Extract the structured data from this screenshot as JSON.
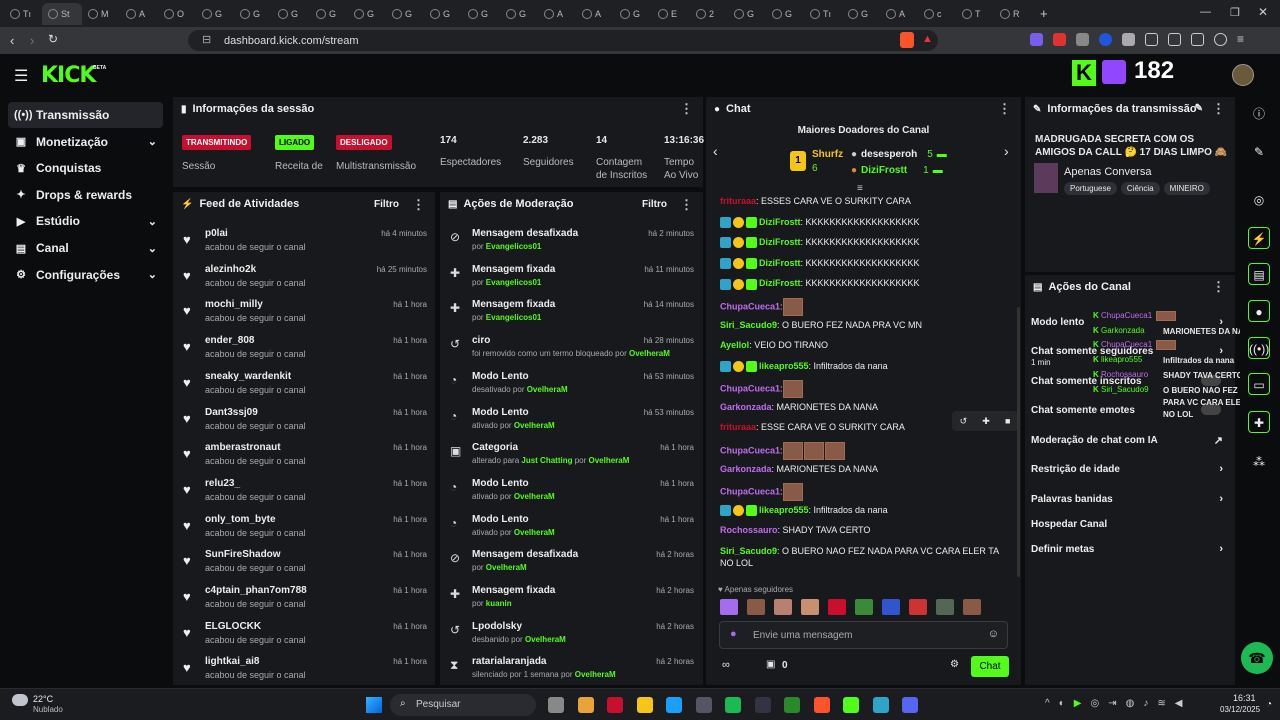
{
  "browser": {
    "tabs": [
      "Tı",
      "St",
      "M",
      "A",
      "O",
      "G",
      "G",
      "G",
      "G",
      "G",
      "G",
      "G",
      "G",
      "G",
      "A",
      "A",
      "G",
      "E",
      "2",
      "G",
      "G",
      "Tı",
      "G",
      "A",
      "c",
      "T",
      "R"
    ],
    "url": "dashboard.kick.com/stream"
  },
  "header": {
    "logo": "KICK",
    "beta": "BETA",
    "viewer_count": "182"
  },
  "sidebar": {
    "items": [
      {
        "label": "Transmissão",
        "icon": "broadcast-icon"
      },
      {
        "label": "Monetização",
        "icon": "money-icon"
      },
      {
        "label": "Conquistas",
        "icon": "trophy-icon"
      },
      {
        "label": "Drops & rewards",
        "icon": "gift-icon"
      },
      {
        "label": "Estúdio",
        "icon": "studio-icon"
      },
      {
        "label": "Canal",
        "icon": "channel-icon"
      },
      {
        "label": "Configurações",
        "icon": "gear-icon"
      }
    ]
  },
  "session": {
    "title": "Informações da sessão",
    "status": [
      {
        "badge": "TRANSMITINDO",
        "label": "Sessão"
      },
      {
        "badge": "LIGADO",
        "label": "Receita de"
      },
      {
        "badge": "DESLIGADO",
        "label": "Multistransmissão"
      }
    ],
    "stats": [
      {
        "value": "174",
        "label": "Espectadores"
      },
      {
        "value": "2.283",
        "label": "Seguidores"
      },
      {
        "value": "14",
        "label": "Contagem de Inscritos"
      },
      {
        "value": "13:16:36",
        "label": "Tempo Ao Vivo"
      }
    ]
  },
  "feed": {
    "title": "Feed de Atividades",
    "filter": "Filtro",
    "items": [
      {
        "name": "p0lai",
        "sub": "acabou de seguir o canal",
        "time": "há 4 minutos"
      },
      {
        "name": "alezinho2k",
        "sub": "acabou de seguir o canal",
        "time": "há 25 minutos"
      },
      {
        "name": "mochi_milly",
        "sub": "acabou de seguir o canal",
        "time": "há 1 hora"
      },
      {
        "name": "ender_808",
        "sub": "acabou de seguir o canal",
        "time": "há 1 hora"
      },
      {
        "name": "sneaky_wardenkit",
        "sub": "acabou de seguir o canal",
        "time": "há 1 hora"
      },
      {
        "name": "Dant3ssj09",
        "sub": "acabou de seguir o canal",
        "time": "há 1 hora"
      },
      {
        "name": "amberastronaut",
        "sub": "acabou de seguir o canal",
        "time": "há 1 hora"
      },
      {
        "name": "relu23_",
        "sub": "acabou de seguir o canal",
        "time": "há 1 hora"
      },
      {
        "name": "only_tom_byte",
        "sub": "acabou de seguir o canal",
        "time": "há 1 hora"
      },
      {
        "name": "SunFireShadow",
        "sub": "acabou de seguir o canal",
        "time": "há 1 hora"
      },
      {
        "name": "c4ptain_phan7om788",
        "sub": "acabou de seguir o canal",
        "time": "há 1 hora"
      },
      {
        "name": "ELGLOCKK",
        "sub": "acabou de seguir o canal",
        "time": "há 1 hora"
      },
      {
        "name": "lightkai_ai8",
        "sub": "acabou de seguir o canal",
        "time": "há 1 hora"
      }
    ]
  },
  "moderation": {
    "title": "Ações de Moderação",
    "filter": "Filtro",
    "items": [
      {
        "name": "Mensagem desafixada",
        "pre": "por ",
        "user": "Evangelicos01",
        "time": "há 2 minutos",
        "icon": "unpin-icon"
      },
      {
        "name": "Mensagem fixada",
        "pre": "por ",
        "user": "Evangelicos01",
        "time": "há 11 minutos",
        "icon": "pin-icon"
      },
      {
        "name": "Mensagem fixada",
        "pre": "por ",
        "user": "Evangelicos01",
        "time": "há 14 minutos",
        "icon": "pin-icon"
      },
      {
        "name": "ciro",
        "pre": "foi removido como um termo bloqueado por ",
        "user": "OvelheraM",
        "time": "há 28 minutos",
        "icon": "undo-icon"
      },
      {
        "name": "Modo Lento",
        "pre": "desativado por ",
        "user": "OvelheraM",
        "time": "há 53 minutos",
        "icon": "snail-icon"
      },
      {
        "name": "Modo Lento",
        "pre": "ativado por ",
        "user": "OvelheraM",
        "time": "há 53 minutos",
        "icon": "snail-icon"
      },
      {
        "name": "Categoria",
        "pre": "alterado para ",
        "user": "Just Chatting",
        "pre2": " por ",
        "user2": "OvelheraM",
        "time": "há 1 hora",
        "icon": "category-icon"
      },
      {
        "name": "Modo Lento",
        "pre": "ativado por ",
        "user": "OvelheraM",
        "time": "há 1 hora",
        "icon": "snail-icon"
      },
      {
        "name": "Modo Lento",
        "pre": "ativado por ",
        "user": "OvelheraM",
        "time": "há 1 hora",
        "icon": "snail-icon"
      },
      {
        "name": "Mensagem desafixada",
        "pre": "por ",
        "user": "OvelheraM",
        "time": "há 2 horas",
        "icon": "unpin-icon"
      },
      {
        "name": "Mensagem fixada",
        "pre": "por ",
        "user": "kuanin",
        "time": "há 2 horas",
        "icon": "pin-icon"
      },
      {
        "name": "Lpodolsky",
        "pre": "desbanido por ",
        "user": "OvelheraM",
        "time": "há 2 horas",
        "icon": "undo-icon"
      },
      {
        "name": "ratarialaranjada",
        "pre": "silenciado por 1 semana por ",
        "user": "OvelheraM",
        "time": "há 2 horas",
        "icon": "hourglass-icon"
      }
    ]
  },
  "chat": {
    "title": "Chat",
    "donors_title": "Maiores Doadores do Canal",
    "donors": [
      {
        "name": "Shurfz",
        "amount": "6"
      },
      {
        "name": "desesperoh",
        "amount": "5"
      },
      {
        "name": "DiziFrostt",
        "amount": "1"
      }
    ],
    "messages": [
      {
        "user": "frituraaa",
        "color": "#c8102e",
        "text": ": ESSES CARA VE O SURKITY CARA",
        "badges": false
      },
      {
        "user": "DiziFrostt",
        "color": "#53fc18",
        "text": ": KKKKKKKKKKKKKKKKKKK",
        "badges": true
      },
      {
        "user": "DiziFrostt",
        "color": "#53fc18",
        "text": ": KKKKKKKKKKKKKKKKKKK",
        "badges": true
      },
      {
        "user": "DiziFrostt",
        "color": "#53fc18",
        "text": ": KKKKKKKKKKKKKKKKKKK",
        "badges": true
      },
      {
        "user": "DiziFrostt",
        "color": "#53fc18",
        "text": ": KKKKKKKKKKKKKKKKKKK",
        "badges": true
      },
      {
        "user": "ChupaCueca1",
        "color": "#c06cf0",
        "text": ":",
        "badges": false,
        "emotes": 1
      },
      {
        "user": "Siri_Sacudo9",
        "color": "#53fc18",
        "text": ": O BUERO FEZ NADA PRA VC MN",
        "badges": false
      },
      {
        "user": "Ayellol",
        "color": "#53fc18",
        "text": ": VEIO DO TIRANO",
        "badges": false
      },
      {
        "user": "likeapro555",
        "color": "#53fc18",
        "text": ": Infiltrados da nana",
        "badges": true
      },
      {
        "user": "ChupaCueca1",
        "color": "#c06cf0",
        "text": ":",
        "badges": false,
        "emotes": 1
      },
      {
        "user": "Garkonzada",
        "color": "#c06cf0",
        "text": ": MARIONETES DA NANA",
        "badges": false
      },
      {
        "user": "frituraaa",
        "color": "#c8102e",
        "text": ": ESSE CARA VE O SURKITY CARA",
        "badges": false
      },
      {
        "user": "ChupaCueca1",
        "color": "#c06cf0",
        "text": ":",
        "badges": false,
        "emotes": 3
      },
      {
        "user": "Garkonzada",
        "color": "#c06cf0",
        "text": ": MARIONETES DA NANA",
        "badges": false
      },
      {
        "user": "ChupaCueca1",
        "color": "#c06cf0",
        "text": ":",
        "badges": false,
        "emotes": 1
      },
      {
        "user": "likeapro555",
        "color": "#53fc18",
        "text": ": Infiltrados da nana",
        "badges": true
      },
      {
        "user": "Rochossauro",
        "color": "#c06cf0",
        "text": ": SHADY TAVA CERTO",
        "badges": false
      },
      {
        "user": "Siri_Sacudo9",
        "color": "#53fc18",
        "text": ": O BUERO NAO FEZ NADA PARA VC CARA ELER TA NO LOL",
        "badges": false
      }
    ],
    "followers_only": "Apenas seguidores",
    "input_placeholder": "Envie uma mensagem",
    "points": "0",
    "send_label": "Chat"
  },
  "stream_info": {
    "title": "Informações da transmissão",
    "stream_title": "MADRUGADA SECRETA COM OS AMIGOS DA CALL 🤔 17 DIAS LIMPO 🙈",
    "category": "Apenas Conversa",
    "tags": [
      "Portuguese",
      "Ciência",
      "MINEIRO"
    ]
  },
  "channel_actions": {
    "title": "Ações do Canal",
    "items": [
      {
        "label": "Modo lento",
        "sub": "",
        "chev": true
      },
      {
        "label": "Chat somente seguidores",
        "sub": "1 min",
        "chev": true
      },
      {
        "label": "Chat somente inscritos",
        "sub": "",
        "toggle": true
      },
      {
        "label": "Chat somente emotes",
        "sub": "",
        "toggle": true
      },
      {
        "label": "Moderação de chat com IA",
        "sub": "",
        "external": true
      },
      {
        "label": "Restrição de idade",
        "sub": "",
        "chev": true
      },
      {
        "label": "Palavras banidas",
        "sub": "",
        "chev": true
      },
      {
        "label": "Hospedar Canal",
        "sub": ""
      },
      {
        "label": "Definir metas",
        "sub": "",
        "chev": true
      }
    ],
    "overlay": [
      {
        "user": "ChupaCueca1",
        "text": ""
      },
      {
        "user": "Garkonzada",
        "text": "MARIONETES DA NANA"
      },
      {
        "user": "ChupaCueca1",
        "text": ""
      },
      {
        "user": "likeapro555",
        "text": "Infiltrados da nana"
      },
      {
        "user": "Rochossauro",
        "text": "SHADY TAVA CERTO"
      },
      {
        "user": "Siri_Sacudo9",
        "text": "O BUERO NAO FEZ NADA PARA VC CARA ELER TA NO LOL"
      }
    ]
  },
  "taskbar": {
    "weather_temp": "22°C",
    "weather_desc": "Nublado",
    "search_placeholder": "Pesquisar",
    "time": "16:31",
    "date": "03/12/2025"
  }
}
